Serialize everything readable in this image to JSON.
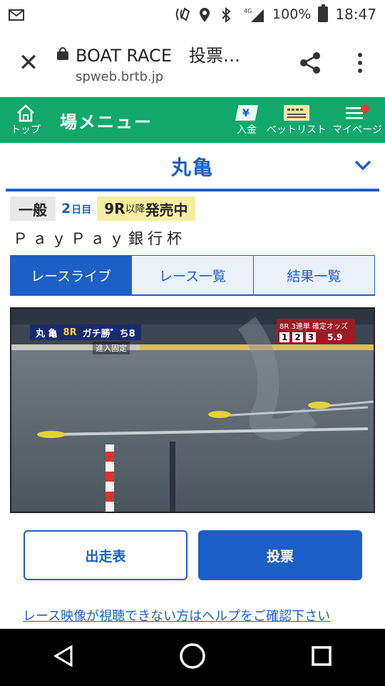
{
  "status_bar": {
    "network": "4G",
    "battery": "100%",
    "time": "18:47"
  },
  "browser": {
    "title": "BOAT RACE　投票…",
    "url": "spweb.brtb.jp"
  },
  "site_header": {
    "home_label": "トップ",
    "menu_title": "場メニュー",
    "deposit_label": "入金",
    "betlist_label": "ベットリスト",
    "mypage_label": "マイページ"
  },
  "venue": {
    "name": "丸亀"
  },
  "race_info": {
    "grade": "一般",
    "day_num": "2",
    "day_unit": "日目",
    "sale_race": "9R",
    "sale_mid": "以降",
    "sale_status": "発売中",
    "title": "ＰａｙＰａｙ銀行杯"
  },
  "tabs": [
    {
      "label": "レースライブ",
      "active": true
    },
    {
      "label": "レース一覧",
      "active": false
    },
    {
      "label": "結果一覧",
      "active": false
    }
  ],
  "video": {
    "overlay_venue": "丸 亀",
    "overlay_race": "8R",
    "overlay_event": "ガチ勝゛ち8",
    "overlay_sub": "進入固定",
    "odds_head": "8R 3連単 確定オッズ",
    "odds_1": "1",
    "odds_2": "2",
    "odds_3": "3",
    "odds_value": "5.9"
  },
  "buttons": {
    "entry_label": "出走表",
    "vote_label": "投票"
  },
  "help_link": "レース映像が視聴できない方はヘルプをご確認下さい",
  "colors": {
    "brand_green": "#12a86a",
    "brand_blue": "#1b5fc7",
    "sale_yellow": "#f7ef9f"
  }
}
